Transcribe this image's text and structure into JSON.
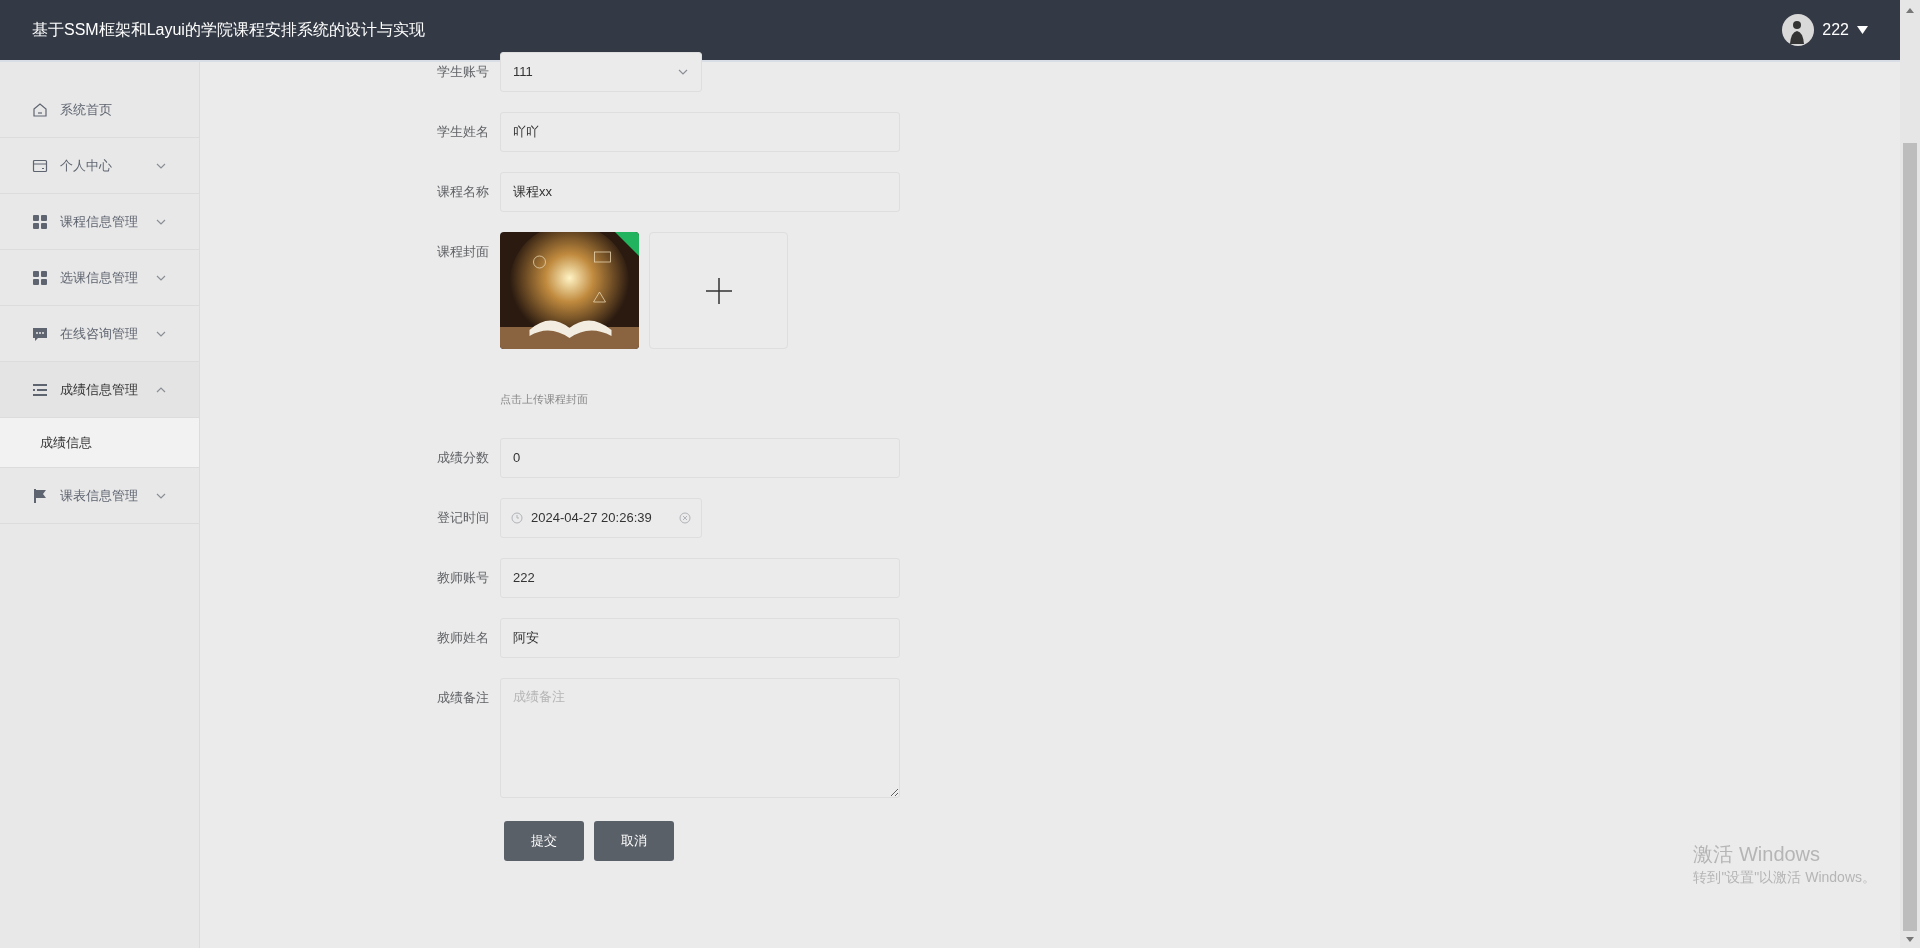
{
  "header": {
    "title": "基于SSM框架和Layui的学院课程安排系统的设计与实现",
    "user": {
      "name": "222"
    }
  },
  "sidebar": {
    "items": [
      {
        "label": "系统首页",
        "kind": "link",
        "expanded": false
      },
      {
        "label": "个人中心",
        "kind": "menu",
        "expanded": false
      },
      {
        "label": "课程信息管理",
        "kind": "menu",
        "expanded": false
      },
      {
        "label": "选课信息管理",
        "kind": "menu",
        "expanded": false
      },
      {
        "label": "在线咨询管理",
        "kind": "menu",
        "expanded": false
      },
      {
        "label": "成绩信息管理",
        "kind": "menu",
        "expanded": true,
        "children": [
          {
            "label": "成绩信息",
            "selected": true
          }
        ]
      },
      {
        "label": "课表信息管理",
        "kind": "menu",
        "expanded": false
      }
    ]
  },
  "form": {
    "fields": [
      {
        "kind": "select",
        "label": "学生账号",
        "value": "111"
      },
      {
        "kind": "text",
        "label": "学生姓名",
        "value": "吖吖"
      },
      {
        "kind": "text",
        "label": "课程名称",
        "value": "课程xx"
      },
      {
        "kind": "upload",
        "label": "课程封面",
        "hint": "点击上传课程封面"
      },
      {
        "kind": "text",
        "label": "成绩分数",
        "value": "0"
      },
      {
        "kind": "date",
        "label": "登记时间",
        "value": "2024-04-27 20:26:39"
      },
      {
        "kind": "text",
        "label": "教师账号",
        "value": "222"
      },
      {
        "kind": "text",
        "label": "教师姓名",
        "value": "阿安"
      },
      {
        "kind": "textarea",
        "label": "成绩备注",
        "placeholder": "成绩备注"
      }
    ],
    "buttons": [
      {
        "label": "提交"
      },
      {
        "label": "取消"
      }
    ]
  },
  "activation": {
    "title": "激活 Windows",
    "subtitle": "转到\"设置\"以激活 Windows。"
  }
}
